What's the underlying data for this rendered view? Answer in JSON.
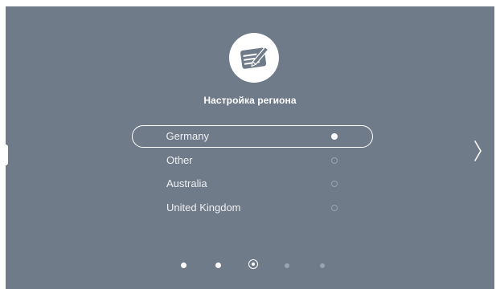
{
  "screen": {
    "title": "Настройка региона",
    "icon": "document-edit-icon"
  },
  "region_options": [
    {
      "label": "Germany",
      "selected": true
    },
    {
      "label": "Other",
      "selected": false
    },
    {
      "label": "Australia",
      "selected": false
    },
    {
      "label": "United Kingdom",
      "selected": false
    }
  ],
  "navigation": {
    "next_icon": "chevron-right-icon",
    "page_count": 5,
    "current_page": 3
  },
  "colors": {
    "background": "#707b8a",
    "foreground": "#ffffff",
    "inactive": "#9aa3af"
  }
}
